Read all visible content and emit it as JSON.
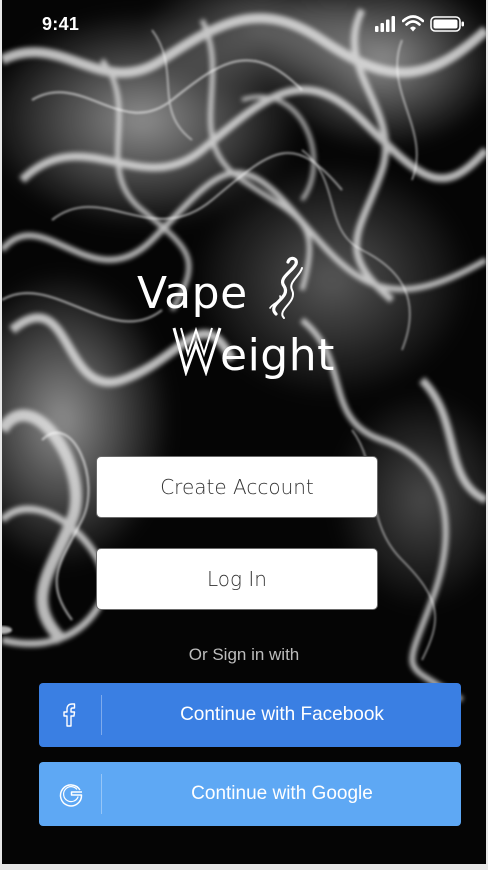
{
  "status_bar": {
    "time": "9:41"
  },
  "logo": {
    "line1": "Vape",
    "line2": "eight",
    "icon": "smoke-swirl-icon"
  },
  "auth": {
    "create_account_label": "Create Account",
    "login_label": "Log In",
    "or_sign_in_with": "Or Sign in with"
  },
  "social": {
    "facebook_label": "Continue with Facebook",
    "google_label": "Continue with Google"
  },
  "colors": {
    "facebook_button": "#3a7fe3",
    "google_button": "#5ea8f4",
    "background": "#050505"
  }
}
